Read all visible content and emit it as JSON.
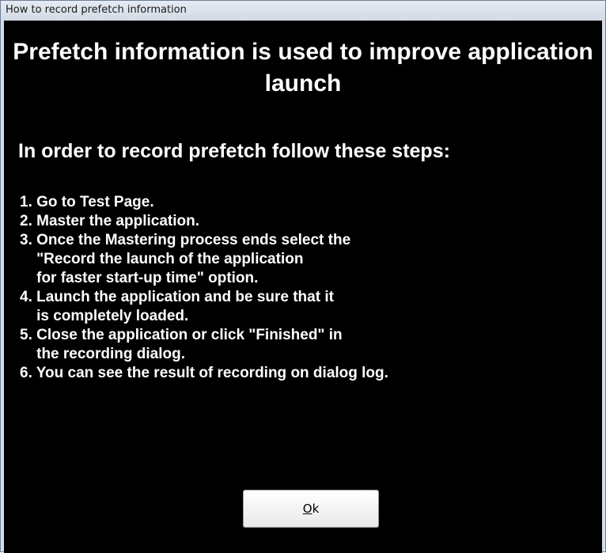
{
  "window": {
    "title": "How to record prefetch information"
  },
  "content": {
    "heading": "Prefetch information is used to improve application launch",
    "subheading": "In order to record prefetch follow these steps:",
    "step_lines": [
      "1. Go to Test Page.",
      "2. Master the application.",
      "3. Once the Mastering process ends select the",
      "    \"Record the launch of the application",
      "    for faster start-up time\" option.",
      "4. Launch the application and be sure that it",
      "    is completely loaded.",
      "5. Close the application or click \"Finished\" in",
      "    the recording dialog.",
      "6. You can see the result of recording on dialog log."
    ]
  },
  "buttons": {
    "ok_mnemonic": "O",
    "ok_rest": "k"
  },
  "colors": {
    "background": "#000000",
    "text": "#ffffff",
    "titlebar": "#d6dde8"
  }
}
